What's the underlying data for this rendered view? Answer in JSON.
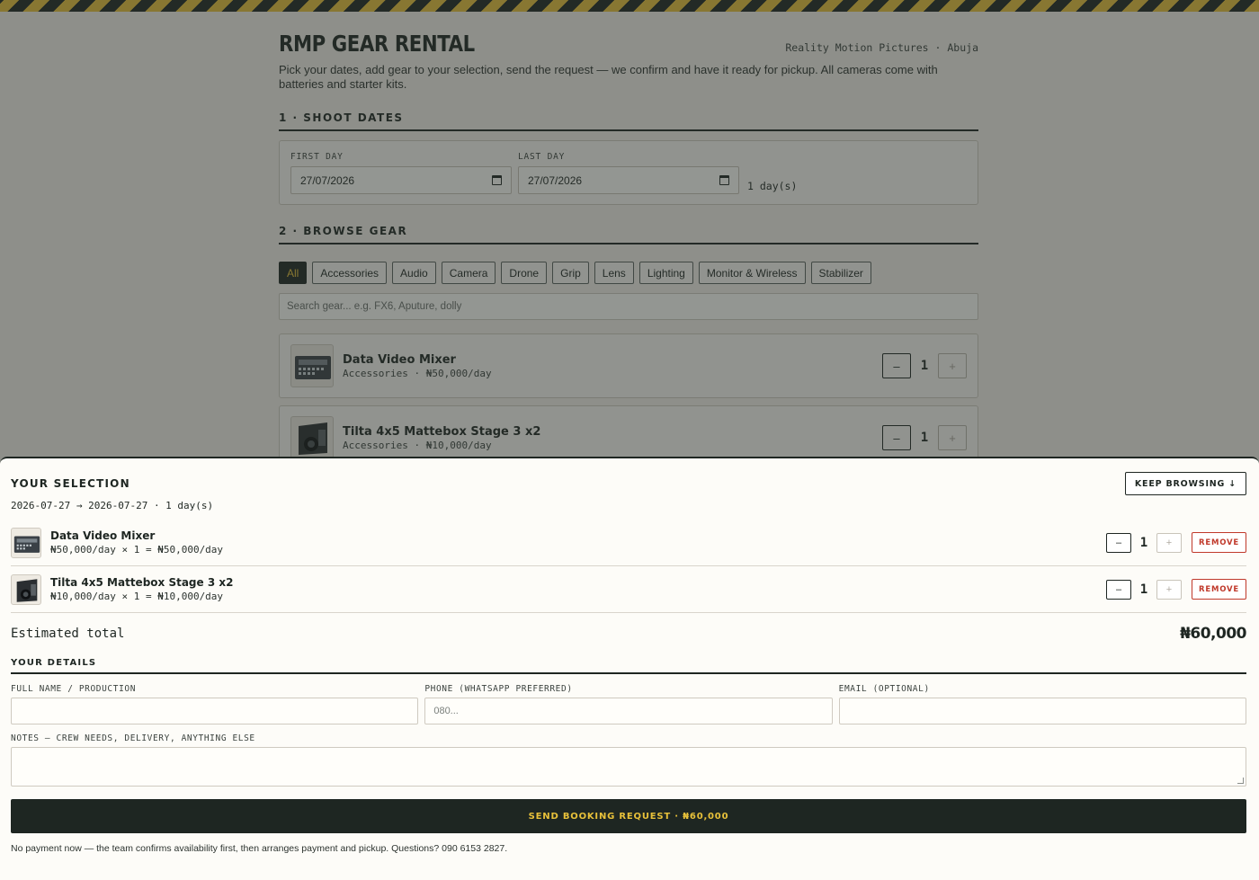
{
  "brand": {
    "title": "RMP GEAR RENTAL",
    "subtitle": "Reality Motion Pictures · Abuja",
    "intro": "Pick your dates, add gear to your selection, send the request — we confirm and have it ready for pickup. All cameras come with batteries and starter kits."
  },
  "dates": {
    "section_title": "1 · SHOOT DATES",
    "first_label": "FIRST DAY",
    "first_value": "27/07/2026",
    "last_label": "LAST DAY",
    "last_value": "27/07/2026",
    "days_count": "1 day(s)"
  },
  "browse": {
    "section_title": "2 · BROWSE GEAR",
    "filters": [
      "All",
      "Accessories",
      "Audio",
      "Camera",
      "Drone",
      "Grip",
      "Lens",
      "Lighting",
      "Monitor & Wireless",
      "Stabilizer"
    ],
    "search_placeholder": "Search gear... e.g. FX6, Aputure, dolly",
    "items": [
      {
        "name": "Data Video Mixer",
        "meta": "Accessories · ₦50,000/day",
        "qty": "1",
        "minus": "–",
        "plus": "+"
      },
      {
        "name": "Tilta 4x5 Mattebox Stage 3 x2",
        "meta": "Accessories · ₦10,000/day",
        "qty": "1",
        "minus": "–",
        "plus": "+"
      }
    ]
  },
  "selection": {
    "title": "YOUR SELECTION",
    "keep_browsing": "KEEP BROWSING ↓",
    "range": "2026-07-27 → 2026-07-27 · 1 day(s)",
    "items": [
      {
        "name": "Data Video Mixer",
        "calc": "₦50,000/day × 1 = ₦50,000/day",
        "qty": "1",
        "minus": "–",
        "plus": "+",
        "remove": "REMOVE"
      },
      {
        "name": "Tilta 4x5 Mattebox Stage 3 x2",
        "calc": "₦10,000/day × 1 = ₦10,000/day",
        "qty": "1",
        "minus": "–",
        "plus": "+",
        "remove": "REMOVE"
      }
    ],
    "total_label": "Estimated total",
    "total_value": "₦60,000"
  },
  "details": {
    "title": "YOUR DETAILS",
    "name_label": "FULL NAME / PRODUCTION",
    "name_value": "",
    "phone_label": "PHONE (WHATSAPP PREFERRED)",
    "phone_placeholder": "080...",
    "email_label": "EMAIL (OPTIONAL)",
    "email_value": "",
    "notes_label": "NOTES — CREW NEEDS, DELIVERY, ANYTHING ELSE",
    "submit": "SEND BOOKING REQUEST · ₦60,000",
    "footnote": "No payment now — the team confirms availability first, then arranges payment and pickup. Questions? 090 6153 2827."
  },
  "colors": {
    "ink": "#1e2622",
    "accent": "#e8c13a",
    "danger": "#c0392b"
  }
}
